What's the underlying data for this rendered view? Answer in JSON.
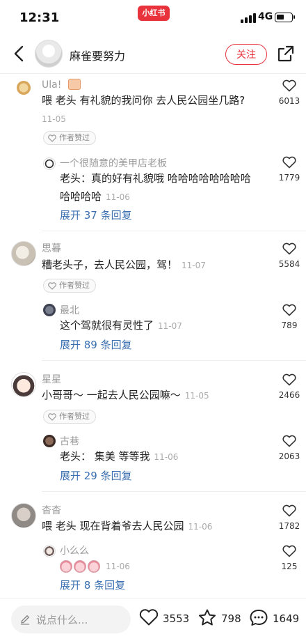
{
  "status_bar": {
    "time": "12:31",
    "app_badge": "小红书",
    "network": "4G"
  },
  "header": {
    "author_name": "麻雀要努力",
    "follow_label": "关注"
  },
  "comments": [
    {
      "name": "Ula!",
      "text": "喂 老头 有礼貌的我问你 去人民公园坐几路?",
      "time": "11-05",
      "badge": "作者赞过",
      "likes": "6013",
      "reply": {
        "name": "一个很随意的美甲店老板",
        "text_line1": "老头：真的好有礼貌哦 哈哈哈哈哈哈哈哈",
        "text_line2": "哈哈哈哈",
        "time": "11-06",
        "likes": "1779"
      },
      "expand": "展开 37 条回复"
    },
    {
      "name": "思暮",
      "text": "糟老头子，去人民公园，驾！",
      "time": "11-07",
      "badge": "作者赞过",
      "likes": "5584",
      "reply": {
        "name": "最北",
        "text": "这个驾就很有灵性了",
        "time": "11-07",
        "likes": "789"
      },
      "expand": "展开 89 条回复"
    },
    {
      "name": "星星",
      "text": "小哥哥～ 一起去人民公园嘛～",
      "time": "11-05",
      "badge": "作者赞过",
      "likes": "2466",
      "reply": {
        "name": "古巷",
        "text": "老头： 集美 等等我",
        "time": "11-06",
        "likes": "2063"
      },
      "expand": "展开 29 条回复"
    },
    {
      "name": "杳杳",
      "text": "喂 老头 现在背着爷去人民公园",
      "time": "11-06",
      "likes": "1782",
      "reply": {
        "name": "小么么",
        "time": "11-06",
        "likes": "125"
      },
      "expand": "展开 8 条回复"
    }
  ],
  "bottom_bar": {
    "placeholder": "说点什么...",
    "likes": "3553",
    "stars": "798",
    "comments": "1649"
  },
  "icons": {
    "back": "chevron-left-icon",
    "share": "share-icon",
    "like": "heart-outline-icon",
    "star": "star-outline-icon",
    "comment": "chat-bubble-icon",
    "edit": "pencil-icon"
  },
  "colors": {
    "brand_red": "#e8323c",
    "link_blue": "#3a6fb0"
  }
}
